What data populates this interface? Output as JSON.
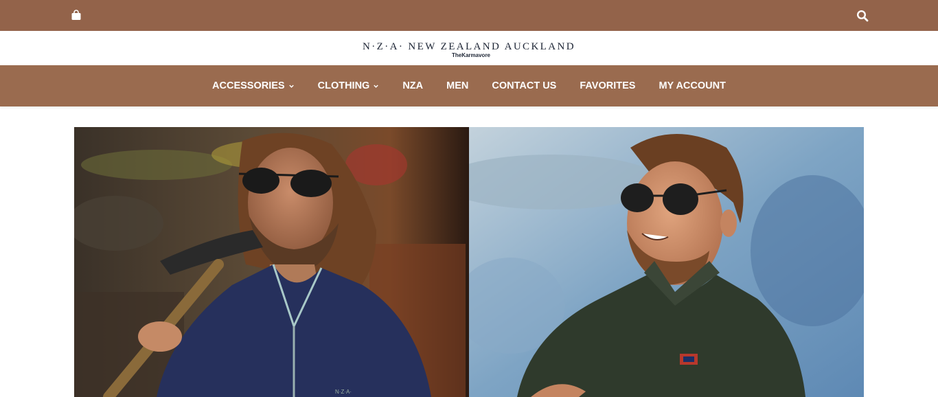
{
  "topbar": {
    "cart_icon": "shopping-bag-icon",
    "search_icon": "search-icon",
    "background": "#93634a"
  },
  "logo": {
    "main": "N·Z·A· NEW ZEALAND AUCKLAND",
    "sub": "TheKarmavore",
    "color": "#1c2434"
  },
  "nav": {
    "background": "#9a6b4f",
    "items": [
      {
        "label": "ACCESSORIES",
        "dropdown": true
      },
      {
        "label": "CLOTHING",
        "dropdown": true
      },
      {
        "label": "NZA",
        "dropdown": false
      },
      {
        "label": "MEN",
        "dropdown": false
      },
      {
        "label": "CONTACT US",
        "dropdown": false
      },
      {
        "label": "FAVORITES",
        "dropdown": false
      },
      {
        "label": "MY ACCOUNT",
        "dropdown": false
      }
    ]
  },
  "hero": {
    "left_sweater_logo": "N·Z·A·"
  }
}
